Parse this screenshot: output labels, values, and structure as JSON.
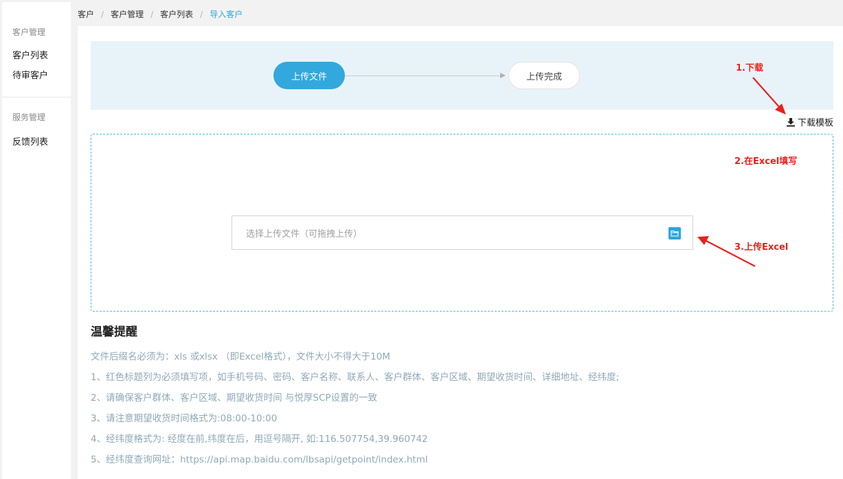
{
  "sidebar": {
    "groups": [
      {
        "title": "客户管理",
        "items": [
          {
            "label": "客户列表"
          },
          {
            "label": "待审客户"
          }
        ]
      },
      {
        "title": "服务管理",
        "items": [
          {
            "label": "反馈列表"
          }
        ]
      }
    ]
  },
  "breadcrumb": [
    {
      "label": "客户"
    },
    {
      "label": "客户管理"
    },
    {
      "label": "客户列表"
    },
    {
      "label": "导入客户"
    }
  ],
  "breadcrumb_separator": "/",
  "steps": [
    {
      "label": "上传文件",
      "state": "active"
    },
    {
      "label": "上传完成",
      "state": "pending"
    }
  ],
  "download_template": {
    "label": "下载模板",
    "icon": "download-icon"
  },
  "upload": {
    "placeholder": "选择上传文件（可拖拽上传）",
    "icon": "folder-icon"
  },
  "tips": {
    "title": "温馨提醒",
    "lines": [
      "文件后缀名必须为：xls 或xlsx （即Excel格式），文件大小不得大于10M",
      "1、红色标题列为必须填写项，如手机号码、密码、客户名称、联系人、客户群体、客户区域、期望收货时间、详细地址、经纬度;",
      "2、请确保客户群体、客户区域、期望收货时间 与悦厚SCP设置的一致",
      "3、请注意期望收货时间格式为:08:00-10:00",
      "4、经纬度格式为: 经度在前,纬度在后，用逗号隔开, 如:116.507754,39.960742",
      "5、经纬度查询网址：https://api.map.baidu.com/lbsapi/getpoint/index.html"
    ]
  },
  "annotations": [
    {
      "label": "1.下载"
    },
    {
      "label": "2.在Excel填写"
    },
    {
      "label": "3.上传Excel"
    }
  ],
  "colors": {
    "accent": "#32a8dc",
    "annotation": "#e8211c",
    "tip_text": "#8fa9b8",
    "steps_bg": "#e8f3f9"
  }
}
